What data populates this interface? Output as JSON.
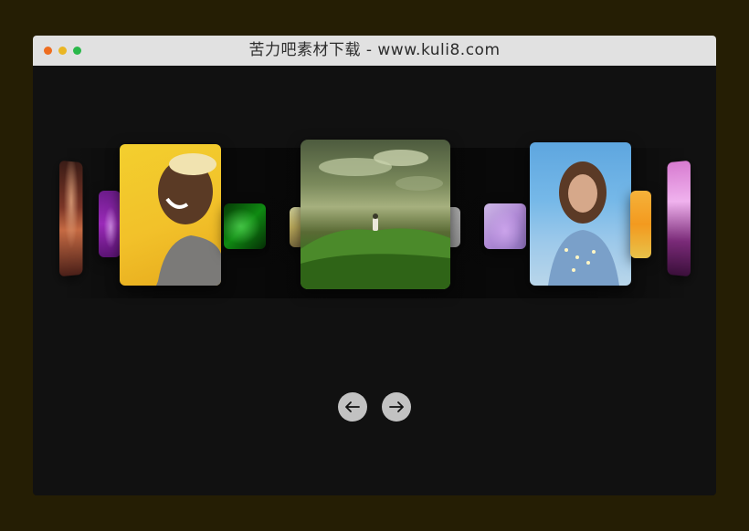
{
  "window": {
    "title": "苦力吧素材下载 - www.kuli8.com"
  },
  "carousel": {
    "cards": [
      {
        "id": "far-left",
        "theme": "portrait-red",
        "active": false
      },
      {
        "id": "left-3",
        "theme": "purple-lying",
        "active": false
      },
      {
        "id": "left-2",
        "theme": "woman-yellow-laughing",
        "active": false
      },
      {
        "id": "left-1",
        "theme": "green-neon",
        "active": false
      },
      {
        "id": "left-0",
        "theme": "small-photo",
        "active": false
      },
      {
        "id": "center",
        "theme": "green-hill-girl",
        "active": true
      },
      {
        "id": "right-0",
        "theme": "small-grey",
        "active": false
      },
      {
        "id": "right-1",
        "theme": "purple-dress",
        "active": false
      },
      {
        "id": "right-2",
        "theme": "woman-lights",
        "active": false
      },
      {
        "id": "right-3",
        "theme": "yellow-orange",
        "active": false
      },
      {
        "id": "far-right",
        "theme": "pink-neon",
        "active": false
      }
    ],
    "controls": {
      "prev_icon": "arrow-left-icon",
      "next_icon": "arrow-right-icon"
    }
  },
  "colors": {
    "page_bg": "#251e04",
    "window_bg": "#111111",
    "titlebar_bg": "#e1e1e1",
    "button_bg": "#c2c2c2"
  }
}
